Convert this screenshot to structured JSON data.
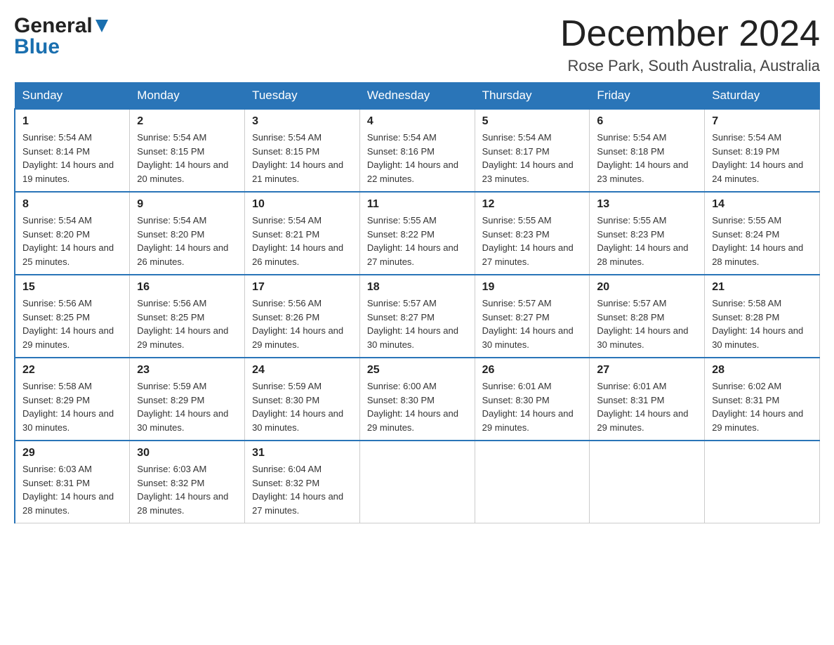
{
  "header": {
    "logo_general": "General",
    "logo_blue": "Blue",
    "title": "December 2024",
    "subtitle": "Rose Park, South Australia, Australia"
  },
  "days_of_week": [
    "Sunday",
    "Monday",
    "Tuesday",
    "Wednesday",
    "Thursday",
    "Friday",
    "Saturday"
  ],
  "weeks": [
    [
      {
        "day": "1",
        "sunrise": "5:54 AM",
        "sunset": "8:14 PM",
        "daylight": "14 hours and 19 minutes."
      },
      {
        "day": "2",
        "sunrise": "5:54 AM",
        "sunset": "8:15 PM",
        "daylight": "14 hours and 20 minutes."
      },
      {
        "day": "3",
        "sunrise": "5:54 AM",
        "sunset": "8:15 PM",
        "daylight": "14 hours and 21 minutes."
      },
      {
        "day": "4",
        "sunrise": "5:54 AM",
        "sunset": "8:16 PM",
        "daylight": "14 hours and 22 minutes."
      },
      {
        "day": "5",
        "sunrise": "5:54 AM",
        "sunset": "8:17 PM",
        "daylight": "14 hours and 23 minutes."
      },
      {
        "day": "6",
        "sunrise": "5:54 AM",
        "sunset": "8:18 PM",
        "daylight": "14 hours and 23 minutes."
      },
      {
        "day": "7",
        "sunrise": "5:54 AM",
        "sunset": "8:19 PM",
        "daylight": "14 hours and 24 minutes."
      }
    ],
    [
      {
        "day": "8",
        "sunrise": "5:54 AM",
        "sunset": "8:20 PM",
        "daylight": "14 hours and 25 minutes."
      },
      {
        "day": "9",
        "sunrise": "5:54 AM",
        "sunset": "8:20 PM",
        "daylight": "14 hours and 26 minutes."
      },
      {
        "day": "10",
        "sunrise": "5:54 AM",
        "sunset": "8:21 PM",
        "daylight": "14 hours and 26 minutes."
      },
      {
        "day": "11",
        "sunrise": "5:55 AM",
        "sunset": "8:22 PM",
        "daylight": "14 hours and 27 minutes."
      },
      {
        "day": "12",
        "sunrise": "5:55 AM",
        "sunset": "8:23 PM",
        "daylight": "14 hours and 27 minutes."
      },
      {
        "day": "13",
        "sunrise": "5:55 AM",
        "sunset": "8:23 PM",
        "daylight": "14 hours and 28 minutes."
      },
      {
        "day": "14",
        "sunrise": "5:55 AM",
        "sunset": "8:24 PM",
        "daylight": "14 hours and 28 minutes."
      }
    ],
    [
      {
        "day": "15",
        "sunrise": "5:56 AM",
        "sunset": "8:25 PM",
        "daylight": "14 hours and 29 minutes."
      },
      {
        "day": "16",
        "sunrise": "5:56 AM",
        "sunset": "8:25 PM",
        "daylight": "14 hours and 29 minutes."
      },
      {
        "day": "17",
        "sunrise": "5:56 AM",
        "sunset": "8:26 PM",
        "daylight": "14 hours and 29 minutes."
      },
      {
        "day": "18",
        "sunrise": "5:57 AM",
        "sunset": "8:27 PM",
        "daylight": "14 hours and 30 minutes."
      },
      {
        "day": "19",
        "sunrise": "5:57 AM",
        "sunset": "8:27 PM",
        "daylight": "14 hours and 30 minutes."
      },
      {
        "day": "20",
        "sunrise": "5:57 AM",
        "sunset": "8:28 PM",
        "daylight": "14 hours and 30 minutes."
      },
      {
        "day": "21",
        "sunrise": "5:58 AM",
        "sunset": "8:28 PM",
        "daylight": "14 hours and 30 minutes."
      }
    ],
    [
      {
        "day": "22",
        "sunrise": "5:58 AM",
        "sunset": "8:29 PM",
        "daylight": "14 hours and 30 minutes."
      },
      {
        "day": "23",
        "sunrise": "5:59 AM",
        "sunset": "8:29 PM",
        "daylight": "14 hours and 30 minutes."
      },
      {
        "day": "24",
        "sunrise": "5:59 AM",
        "sunset": "8:30 PM",
        "daylight": "14 hours and 30 minutes."
      },
      {
        "day": "25",
        "sunrise": "6:00 AM",
        "sunset": "8:30 PM",
        "daylight": "14 hours and 29 minutes."
      },
      {
        "day": "26",
        "sunrise": "6:01 AM",
        "sunset": "8:30 PM",
        "daylight": "14 hours and 29 minutes."
      },
      {
        "day": "27",
        "sunrise": "6:01 AM",
        "sunset": "8:31 PM",
        "daylight": "14 hours and 29 minutes."
      },
      {
        "day": "28",
        "sunrise": "6:02 AM",
        "sunset": "8:31 PM",
        "daylight": "14 hours and 29 minutes."
      }
    ],
    [
      {
        "day": "29",
        "sunrise": "6:03 AM",
        "sunset": "8:31 PM",
        "daylight": "14 hours and 28 minutes."
      },
      {
        "day": "30",
        "sunrise": "6:03 AM",
        "sunset": "8:32 PM",
        "daylight": "14 hours and 28 minutes."
      },
      {
        "day": "31",
        "sunrise": "6:04 AM",
        "sunset": "8:32 PM",
        "daylight": "14 hours and 27 minutes."
      },
      null,
      null,
      null,
      null
    ]
  ],
  "labels": {
    "sunrise": "Sunrise:",
    "sunset": "Sunset:",
    "daylight": "Daylight:"
  }
}
